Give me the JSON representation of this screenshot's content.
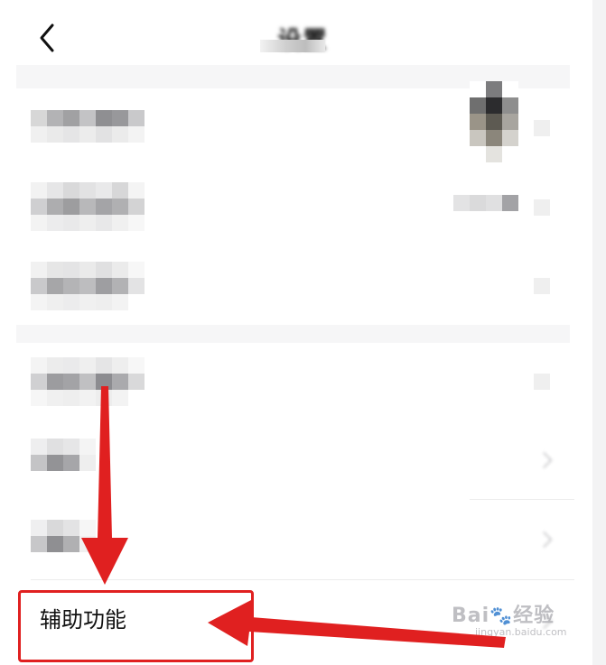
{
  "header": {
    "title": "设置"
  },
  "rows": {
    "accessibility_label": "辅助功能"
  },
  "annotation": {
    "highlight_color": "#e02020"
  },
  "watermark": {
    "brand": "Bai",
    "brand_suffix": "经验",
    "domain": "jingyan.baidu.com"
  }
}
